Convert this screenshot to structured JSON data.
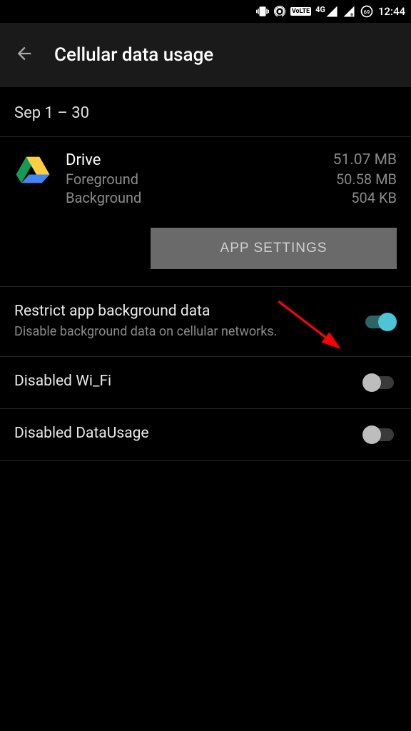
{
  "status_bar": {
    "time": "12:44",
    "battery_percent": "69"
  },
  "header": {
    "title": "Cellular data usage"
  },
  "date_range": "Sep 1 – 30",
  "app": {
    "name": "Drive",
    "total": "51.07 MB",
    "foreground_label": "Foreground",
    "foreground_value": "50.58 MB",
    "background_label": "Background",
    "background_value": "504 KB"
  },
  "app_settings_button": "APP SETTINGS",
  "settings": [
    {
      "title": "Restrict app background data",
      "subtitle": "Disable background data on cellular networks.",
      "enabled": true
    },
    {
      "title": "Disabled Wi_Fi",
      "subtitle": "",
      "enabled": false
    },
    {
      "title": "Disabled DataUsage",
      "subtitle": "",
      "enabled": false
    }
  ]
}
